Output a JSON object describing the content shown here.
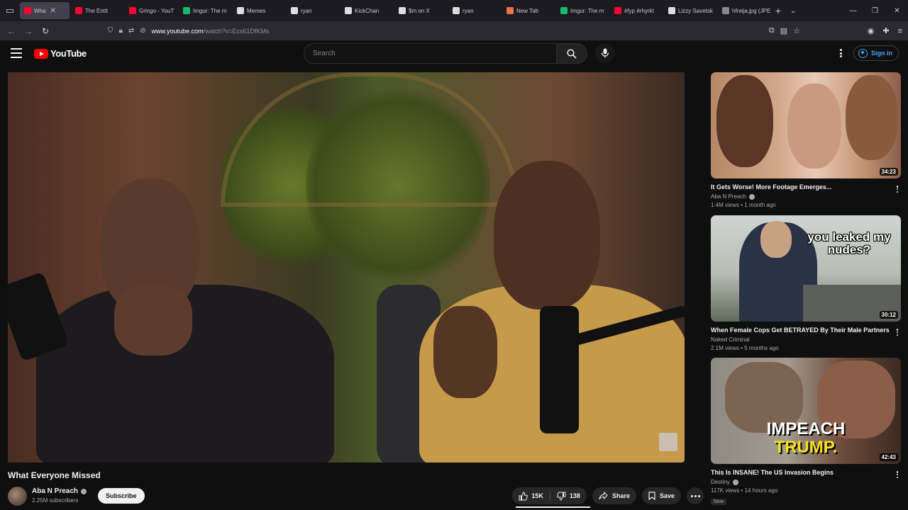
{
  "browser": {
    "tabs": [
      {
        "label": "Wha",
        "active": true,
        "fav_color": "#ff0033"
      },
      {
        "label": "The Entit",
        "active": false,
        "fav_color": "#ff0033"
      },
      {
        "label": "Gringo - YouT",
        "active": false,
        "fav_color": "#ff0033"
      },
      {
        "label": "Imgur: The m",
        "active": false,
        "fav_color": "#1bb76e"
      },
      {
        "label": "Memes",
        "active": false,
        "fav_color": "#dddddd"
      },
      {
        "label": "ryan",
        "active": false,
        "fav_color": "#dddddd"
      },
      {
        "label": "KickChan",
        "active": false,
        "fav_color": "#dddddd"
      },
      {
        "label": "$m on X",
        "active": false,
        "fav_color": "#dddddd"
      },
      {
        "label": "ryan",
        "active": false,
        "fav_color": "#dddddd"
      },
      {
        "label": "New Tab",
        "active": false,
        "fav_color": "#e8734a"
      },
      {
        "label": "Imgur: The m",
        "active": false,
        "fav_color": "#1bb76e"
      },
      {
        "label": "#fyp #rhyrkt",
        "active": false,
        "fav_color": "#ff0033"
      },
      {
        "label": "Lizzy Savetsk",
        "active": false,
        "fav_color": "#dddddd"
      },
      {
        "label": "hfreija.jpg (JPEG",
        "active": false,
        "fav_color": "#888888"
      }
    ],
    "new_tab_label": "+",
    "tab_list_label": "⌄",
    "url_host": "www.youtube.com",
    "url_path": "/watch?v=Ecs61DfKMs"
  },
  "youtube": {
    "logo_text": "YouTube",
    "search": {
      "placeholder": "Search"
    },
    "signin_label": "Sign in"
  },
  "video": {
    "title": "What Everyone Missed",
    "channel": "Aba N Preach",
    "subscribers": "2.25M subscribers",
    "subscribe_label": "Subscribe",
    "likes": "15K",
    "dislikes": "138",
    "share_label": "Share",
    "save_label": "Save"
  },
  "recommendations": [
    {
      "title": "It Gets Worse! More Footage Emerges...",
      "channel": "Aba N Preach",
      "meta": "1.4M views • 1 month ago",
      "duration": "34:23",
      "badge": ""
    },
    {
      "title": "When Female Cops Get BETRAYED By Their Male Partners",
      "channel": "Naked Criminal",
      "meta": "2.1M views • 5 months ago",
      "duration": "30:12",
      "badge": "",
      "thumb_text": "you leaked my nudes?"
    },
    {
      "title": "This Is INSANE! The US Invasion Begins",
      "channel": "Destiny",
      "meta": "117K views • 14 hours ago",
      "duration": "42:43",
      "badge": "New",
      "thumb_text_1": "IMPEACH",
      "thumb_text_2": "TRUMP."
    }
  ],
  "colors": {
    "youtube_red": "#ff0000",
    "link_blue": "#3ea6ff",
    "page_bg": "#0f0f0f"
  }
}
